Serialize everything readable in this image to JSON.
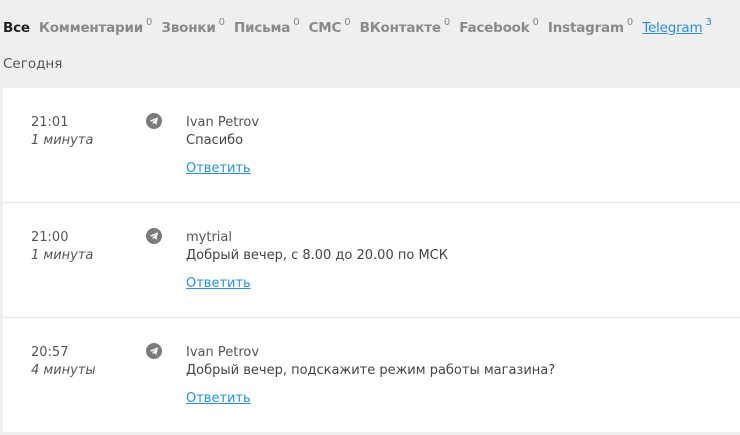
{
  "tabs": [
    {
      "label": "Все",
      "count": ""
    },
    {
      "label": "Комментарии",
      "count": "0"
    },
    {
      "label": "Звонки",
      "count": "0"
    },
    {
      "label": "Письма",
      "count": "0"
    },
    {
      "label": "СМС",
      "count": "0"
    },
    {
      "label": "ВКонтакте",
      "count": "0"
    },
    {
      "label": "Facebook",
      "count": "0"
    },
    {
      "label": "Instagram",
      "count": "0"
    },
    {
      "label": "Telegram",
      "count": "3"
    }
  ],
  "date_label": "Сегодня",
  "messages": [
    {
      "time": "21:01",
      "ago": "1 минута",
      "author": "Ivan Petrov",
      "text": "Спасибо",
      "reply_label": "Ответить",
      "icon": "telegram-icon"
    },
    {
      "time": "21:00",
      "ago": "1 минута",
      "author": "mytrial",
      "text": "Добрый вечер, с 8.00 до 20.00 по МСК",
      "reply_label": "Ответить",
      "icon": "telegram-icon"
    },
    {
      "time": "20:57",
      "ago": "4 минуты",
      "author": "Ivan Petrov",
      "text": "Добрый вечер, подскажите режим работы магазина?",
      "reply_label": "Ответить",
      "icon": "telegram-icon"
    }
  ],
  "colors": {
    "link": "#2a8fd6",
    "background": "#efefef",
    "icon": "#7b7b7b"
  }
}
